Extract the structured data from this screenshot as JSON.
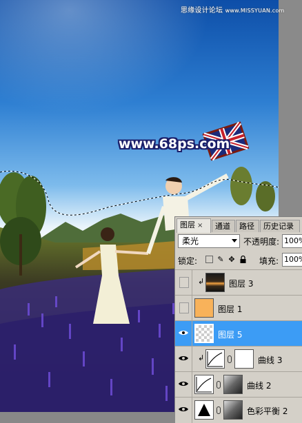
{
  "watermark": {
    "cn": "思缘设计论坛",
    "url": "www.MISSYUAN.com"
  },
  "site_mark": "www.68ps.com",
  "panel": {
    "tabs": [
      {
        "label": "图层",
        "close": "×"
      },
      {
        "label": "通道"
      },
      {
        "label": "路径"
      },
      {
        "label": "历史记录"
      }
    ],
    "blend_mode": "柔光",
    "opacity_label": "不透明度:",
    "opacity_value": "100%",
    "lock_label": "锁定:",
    "lock_icons": [
      "transparency-lock-icon",
      "brush-lock-icon",
      "move-lock-icon",
      "padlock-icon"
    ],
    "fill_label": "填充:",
    "fill_value": "100%",
    "layers": [
      {
        "name": "图层 3",
        "visible": false,
        "clipped": true,
        "thumb": "sunset-photo"
      },
      {
        "name": "图层 1",
        "visible": false,
        "clipped": false,
        "thumb": "orange-fill",
        "color": "#f8b25a"
      },
      {
        "name": "图层 5",
        "visible": true,
        "clipped": false,
        "thumb": "transparent",
        "selected": true
      },
      {
        "name": "曲线 3",
        "visible": true,
        "clipped": true,
        "thumb": "curves-adjustment",
        "mask": "white"
      },
      {
        "name": "曲线 2",
        "visible": true,
        "clipped": false,
        "thumb": "curves-adjustment",
        "mask": "gray-photo"
      },
      {
        "name": "色彩平衡 2",
        "visible": true,
        "clipped": false,
        "thumb": "color-balance-adjustment",
        "mask": "gray-photo"
      }
    ]
  },
  "colors": {
    "selected_row": "#3c9cf5",
    "panel_bg": "#d4d0c8",
    "site_mark_outline": "#1b1f6a"
  }
}
